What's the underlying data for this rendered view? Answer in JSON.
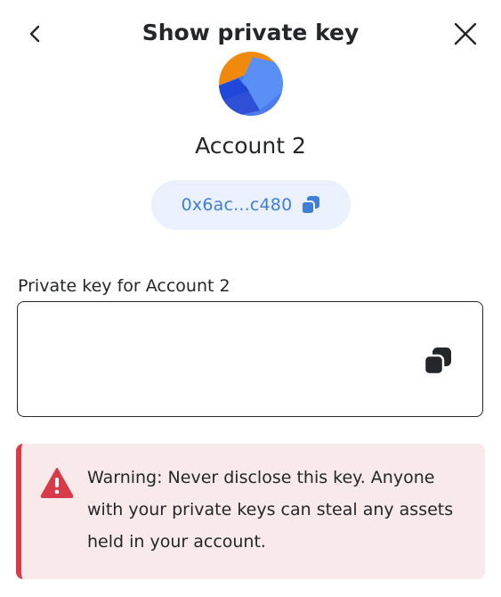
{
  "header": {
    "title": "Show private key",
    "back_icon": "chevron-left-icon",
    "close_icon": "close-icon"
  },
  "account": {
    "name": "Account 2",
    "address_short": "0x6ac...c480",
    "copy_icon": "copy-icon"
  },
  "private_key": {
    "label": "Private key for Account 2",
    "value": "",
    "copy_icon": "copy-icon"
  },
  "warning": {
    "icon": "warning-triangle-icon",
    "text": "Warning: Never disclose this key. Anyone with your private keys can steal any assets held in your account."
  },
  "colors": {
    "accent_blue": "#3f7fd6",
    "pill_bg": "#eaf1fc",
    "warning_bg": "#f8eaea",
    "warning_red": "#d73a49",
    "text_dark": "#24272a"
  }
}
